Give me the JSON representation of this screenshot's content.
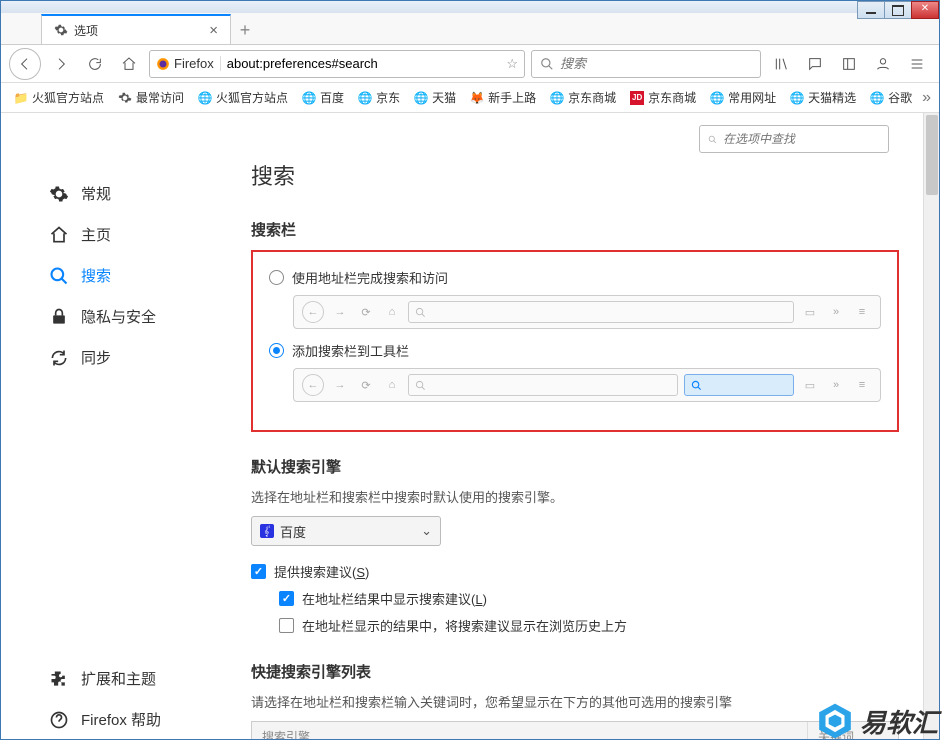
{
  "window": {
    "title": "选项"
  },
  "tab": {
    "label": "选项"
  },
  "nav": {
    "identity_label": "Firefox",
    "url": "about:preferences#search",
    "search_placeholder": "搜索"
  },
  "bookmarks": {
    "items": [
      {
        "label": "火狐官方站点",
        "icon": "firefox"
      },
      {
        "label": "最常访问",
        "icon": "gear"
      },
      {
        "label": "火狐官方站点",
        "icon": "globe"
      },
      {
        "label": "百度",
        "icon": "globe"
      },
      {
        "label": "京东",
        "icon": "globe"
      },
      {
        "label": "天猫",
        "icon": "globe"
      },
      {
        "label": "新手上路",
        "icon": "firefox"
      },
      {
        "label": "京东商城",
        "icon": "globe"
      },
      {
        "label": "京东商城",
        "icon": "jd"
      },
      {
        "label": "常用网址",
        "icon": "globe"
      },
      {
        "label": "天猫精选",
        "icon": "globe"
      },
      {
        "label": "谷歌",
        "icon": "globe"
      }
    ]
  },
  "find_placeholder": "在选项中查找",
  "sidebar": {
    "items": [
      {
        "id": "general",
        "label": "常规"
      },
      {
        "id": "home",
        "label": "主页"
      },
      {
        "id": "search",
        "label": "搜索",
        "active": true
      },
      {
        "id": "privacy",
        "label": "隐私与安全"
      },
      {
        "id": "sync",
        "label": "同步"
      }
    ],
    "footer": [
      {
        "id": "extensions",
        "label": "扩展和主题"
      },
      {
        "id": "help",
        "label": "Firefox 帮助"
      }
    ]
  },
  "main": {
    "title": "搜索",
    "searchbar": {
      "heading": "搜索栏",
      "option_combined": "使用地址栏完成搜索和访问",
      "option_separate": "添加搜索栏到工具栏"
    },
    "default_engine": {
      "heading": "默认搜索引擎",
      "desc": "选择在地址栏和搜索栏中搜索时默认使用的搜索引擎。",
      "selected": "百度",
      "checkbox_suggest": "提供搜索建议(",
      "checkbox_suggest_key": "S",
      "checkbox_suggest_end": ")",
      "checkbox_urlbar": "在地址栏结果中显示搜索建议(",
      "checkbox_urlbar_key": "L",
      "checkbox_urlbar_end": ")",
      "checkbox_history": "在地址栏显示的结果中，将搜索建议显示在浏览历史上方"
    },
    "oneclick": {
      "heading": "快捷搜索引擎列表",
      "desc": "请选择在地址栏和搜索栏输入关键词时，您希望显示在下方的其他可选用的搜索引擎",
      "col_name": "搜索引擎",
      "col_keyword": "关键词"
    }
  },
  "watermark": "易软汇"
}
